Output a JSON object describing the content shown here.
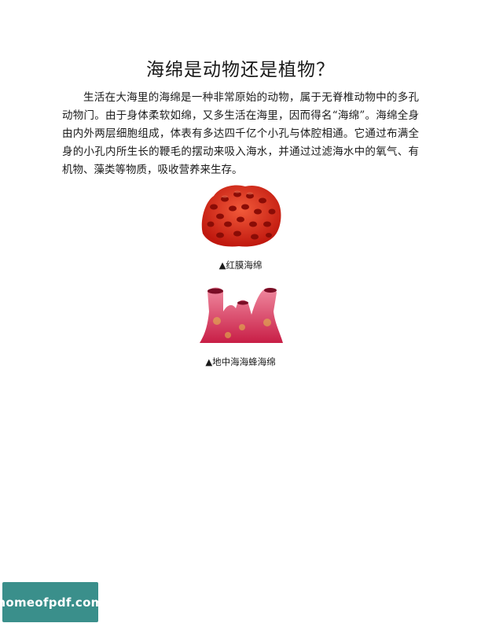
{
  "article": {
    "title": "海绵是动物还是植物？",
    "body": "生活在大海里的海绵是一种非常原始的动物，属于无脊椎动物中的多孔动物门。由于身体柔软如绵，又多生活在海里，因而得名“海绵”。海绵全身由内外两层细胞组成，体表有多达四千亿个小孔与体腔相通。它通过布满全身的小孔内所生长的鞭毛的摆动来吸入海水，并通过过滤海水中的氧气、有机物、藻类等物质，吸收营养来生存。"
  },
  "figures": [
    {
      "caption": "▲红膜海绵",
      "image": "red-sponge-illustration",
      "color": "#d8261a"
    },
    {
      "caption": "▲地中海海蜂海绵",
      "image": "pink-tube-sponge-illustration",
      "color": "#d23a5c"
    }
  ],
  "watermark": {
    "text": "homeofpdf.com",
    "color": "#3a8f8b"
  }
}
